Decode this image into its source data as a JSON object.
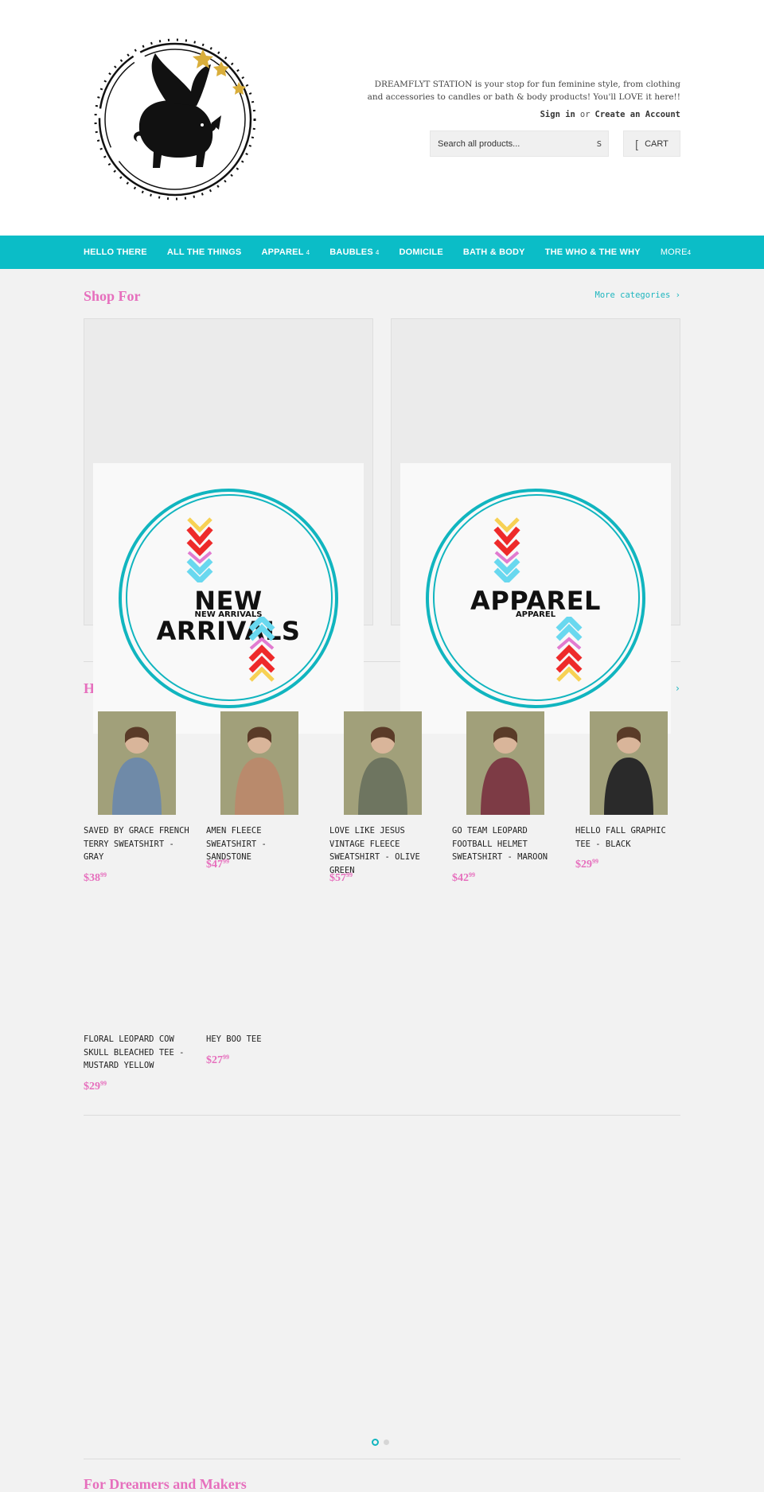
{
  "header": {
    "tagline": "DREAMFLYT STATION is your stop for fun feminine style, from clothing and accessories to candles or bath & body products! You'll LOVE it here!!",
    "sign_in": "Sign in",
    "or": "or",
    "create_account": "Create an Account",
    "search_placeholder": "Search all products...",
    "search_icon": "s",
    "cart_icon": "[",
    "cart_label": "CART",
    "logo_icon": "flying-pig-logo-icon"
  },
  "nav": {
    "items": [
      {
        "label": "HELLO THERE",
        "has_dropdown": false
      },
      {
        "label": "ALL THE THINGS",
        "has_dropdown": false
      },
      {
        "label": "APPAREL",
        "has_dropdown": true
      },
      {
        "label": "BAUBLES",
        "has_dropdown": true
      },
      {
        "label": "DOMICILE",
        "has_dropdown": false
      },
      {
        "label": "BATH & BODY",
        "has_dropdown": false
      },
      {
        "label": "THE WHO & THE WHY",
        "has_dropdown": false
      },
      {
        "label": "MORE",
        "has_dropdown": true
      }
    ],
    "dropdown_glyph": "4"
  },
  "shop_for": {
    "title": "Shop For",
    "more_link": "More categories ›",
    "categories": [
      {
        "big": "NEW ARRIVALS",
        "small": "NEW ARRIVALS"
      },
      {
        "big": "APPAREL",
        "small": "APPAREL"
      }
    ]
  },
  "highlights": {
    "title": "H",
    "arrow": "›"
  },
  "products": [
    {
      "name": "SAVED BY GRACE FRENCH TERRY SWEATSHIRT - GRAY",
      "price": "$38",
      "cents": "99",
      "color": "#6f8aa8"
    },
    {
      "name": "AMEN FLEECE SWEATSHIRT - SANDSTONE",
      "price": "$47",
      "cents": "99",
      "color": "#b98a6c"
    },
    {
      "name": "LOVE LIKE JESUS VINTAGE FLEECE SWEATSHIRT - OLIVE GREEN",
      "price": "$57",
      "cents": "99",
      "color": "#6e7560"
    },
    {
      "name": "GO TEAM LEOPARD FOOTBALL HELMET SWEATSHIRT - MAROON",
      "price": "$42",
      "cents": "99",
      "color": "#7d3b45"
    },
    {
      "name": "HELLO FALL GRAPHIC TEE - BLACK",
      "price": "$29",
      "cents": "99",
      "color": "#2a2a2a"
    },
    {
      "name": "FLORAL LEOPARD COW SKULL BLEACHED TEE - MUSTARD YELLOW",
      "price": "$29",
      "cents": "99",
      "color": null
    },
    {
      "name": "HEY BOO TEE",
      "price": "$27",
      "cents": "99",
      "color": null
    }
  ],
  "carousel": {
    "active": 0,
    "count": 2
  },
  "footer": {
    "title": "For Dreamers and Makers"
  },
  "colors": {
    "accent": "#0bbdc7",
    "pink": "#e66fbd",
    "link": "#1fb6bf"
  }
}
